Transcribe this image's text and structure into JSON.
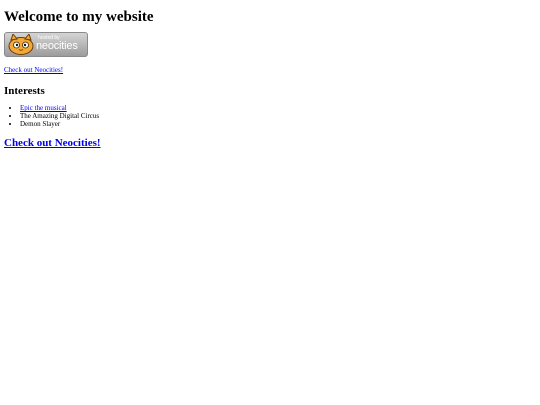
{
  "page": {
    "title": "Welcome to my website",
    "badge": {
      "line1": "hosted by",
      "line2": "neocities"
    },
    "small_link": "Check out Neocities!",
    "interests_heading": "Interests",
    "interests": [
      {
        "label": "Epic the musical",
        "link": true
      },
      {
        "label": "The Amazing Digital Circus",
        "link": false
      },
      {
        "label": "Demon Slayer",
        "link": false
      }
    ],
    "big_link": "Check out Neocities!"
  },
  "colors": {
    "link": "#0000ee",
    "text": "#000000",
    "background": "#ffffff"
  }
}
